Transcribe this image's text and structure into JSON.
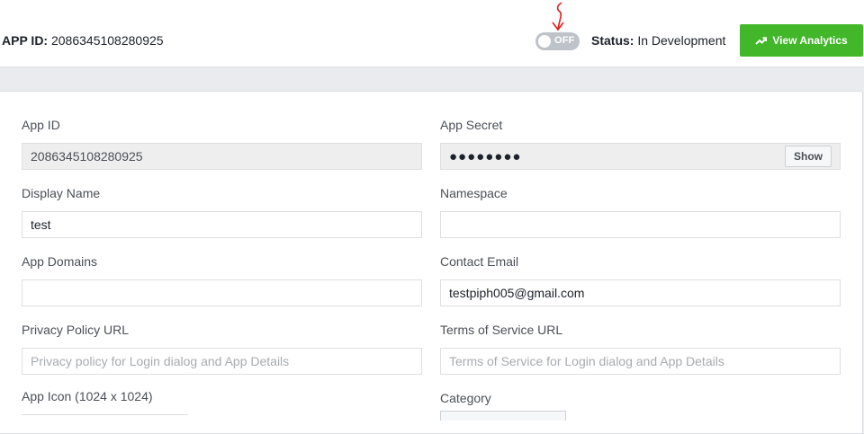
{
  "header": {
    "app_id_label": "APP ID:",
    "app_id_value": "2086345108280925",
    "toggle_text": "OFF",
    "status_label": "Status:",
    "status_value": "In Development",
    "analytics_button": "View Analytics"
  },
  "form": {
    "app_id": {
      "label": "App ID",
      "value": "2086345108280925"
    },
    "app_secret": {
      "label": "App Secret",
      "value": "●●●●●●●●",
      "show_button": "Show"
    },
    "display_name": {
      "label": "Display Name",
      "value": "test"
    },
    "namespace": {
      "label": "Namespace",
      "value": ""
    },
    "app_domains": {
      "label": "App Domains",
      "value": ""
    },
    "contact_email": {
      "label": "Contact Email",
      "value": "testpiph005@gmail.com"
    },
    "privacy_policy": {
      "label": "Privacy Policy URL",
      "placeholder": "Privacy policy for Login dialog and App Details"
    },
    "terms_of_service": {
      "label": "Terms of Service URL",
      "placeholder": "Terms of Service for Login dialog and App Details"
    },
    "app_icon": {
      "label": "App Icon (1024 x 1024)"
    },
    "category": {
      "label": "Category"
    }
  },
  "colors": {
    "accent_green": "#42b72a",
    "annotation_red": "#e0201b",
    "toggle_off": "#bec3c9"
  }
}
